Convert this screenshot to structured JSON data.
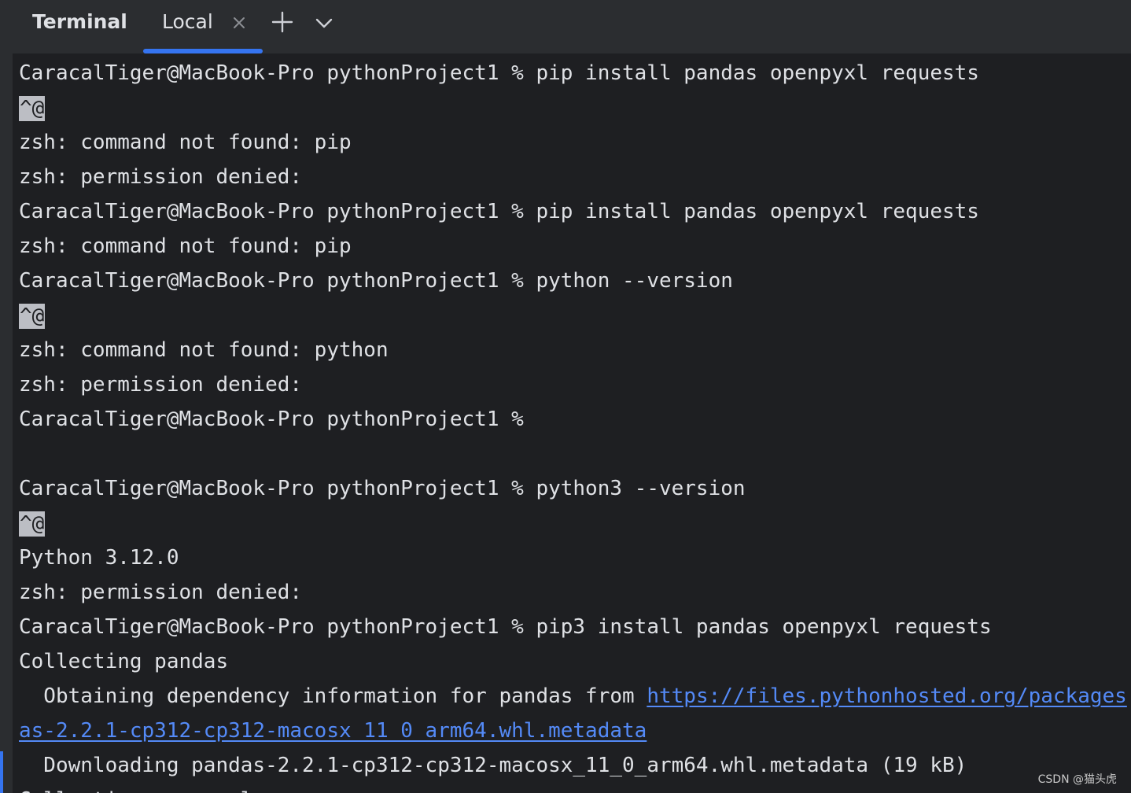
{
  "toolwindow": {
    "title": "Terminal",
    "tabs": [
      {
        "label": "Local",
        "active": true
      }
    ],
    "accent_color": "#3574f0"
  },
  "icons": {
    "tab_close": "close-icon",
    "add_tab": "plus-icon",
    "tab_menu": "chevron-down-icon"
  },
  "terminal": {
    "lines": [
      {
        "type": "text",
        "text": "CaracalTiger@MacBook-Pro pythonProject1 % pip install pandas openpyxl requests"
      },
      {
        "type": "caret",
        "text": "^@"
      },
      {
        "type": "text",
        "text": "zsh: command not found: pip"
      },
      {
        "type": "text",
        "text": "zsh: permission denied:"
      },
      {
        "type": "text",
        "text": "CaracalTiger@MacBook-Pro pythonProject1 % pip install pandas openpyxl requests"
      },
      {
        "type": "text",
        "text": "zsh: command not found: pip"
      },
      {
        "type": "text",
        "text": "CaracalTiger@MacBook-Pro pythonProject1 % python --version"
      },
      {
        "type": "caret",
        "text": "^@"
      },
      {
        "type": "text",
        "text": "zsh: command not found: python"
      },
      {
        "type": "text",
        "text": "zsh: permission denied:"
      },
      {
        "type": "text",
        "text": "CaracalTiger@MacBook-Pro pythonProject1 %"
      },
      {
        "type": "text",
        "text": ""
      },
      {
        "type": "text",
        "text": "CaracalTiger@MacBook-Pro pythonProject1 % python3 --version"
      },
      {
        "type": "caret",
        "text": "^@"
      },
      {
        "type": "text",
        "text": "Python 3.12.0"
      },
      {
        "type": "text",
        "text": "zsh: permission denied:"
      },
      {
        "type": "text",
        "text": "CaracalTiger@MacBook-Pro pythonProject1 % pip3 install pandas openpyxl requests"
      },
      {
        "type": "text",
        "text": "Collecting pandas"
      },
      {
        "type": "mixed",
        "text": "  Obtaining dependency information for pandas from ",
        "link": "https://files.pythonhosted.org/packages"
      },
      {
        "type": "link",
        "text": "as-2.2.1-cp312-cp312-macosx_11_0_arm64.whl.metadata"
      },
      {
        "type": "text",
        "text": "  Downloading pandas-2.2.1-cp312-cp312-macosx_11_0_arm64.whl.metadata (19 kB)"
      },
      {
        "type": "text",
        "text": "Collecting openpyxl"
      }
    ]
  },
  "watermark": "CSDN @猫头虎"
}
